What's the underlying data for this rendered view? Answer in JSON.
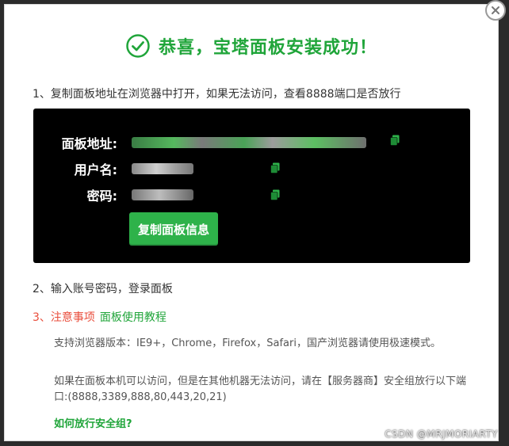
{
  "dialog": {
    "title": "恭喜，宝塔面板安装成功！",
    "close_icon": "close-icon",
    "success_icon": "check-circle-icon"
  },
  "steps": {
    "step1": "1、复制面板地址在浏览器中打开，如果无法访问，查看8888端口是否放行",
    "step2": "2、输入账号密码，登录面板",
    "step3_label": "3、注意事项",
    "step3_link": "面板使用教程"
  },
  "panel": {
    "address_label": "面板地址:",
    "username_label": "用户名:",
    "password_label": "密码:",
    "copy_button": "复制面板信息",
    "copy_icon": "copy-icon"
  },
  "notes": {
    "browsers": "支持浏览器版本：IE9+，Chrome，Firefox，Safari，国产浏览器请使用极速模式。",
    "firewall": "如果在面板本机可以访问，但是在其他机器无法访问，请在【服务器商】安全组放行以下端口:(8888,3389,888,80,443,20,21)",
    "security_group_link": "如何放行安全组?"
  },
  "watermark": "CSDN @MRJMORIARTY",
  "colors": {
    "brand_green": "#20a53a",
    "button_green": "#2eb24a",
    "warning_red": "#e94e3c",
    "panel_bg": "#000000"
  }
}
